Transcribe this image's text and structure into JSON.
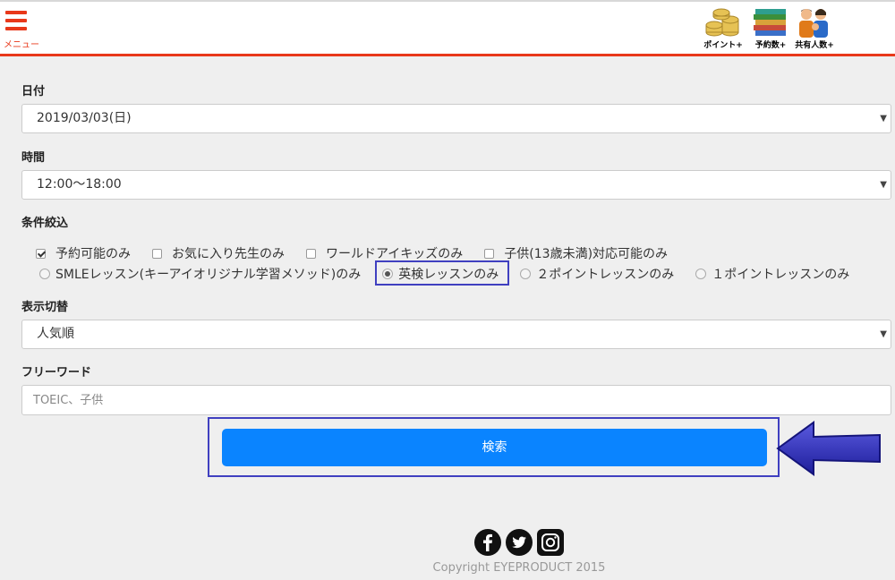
{
  "header": {
    "menu_label": "メニュー",
    "icons": [
      {
        "label": "ポイント+",
        "icon": "coins-icon"
      },
      {
        "label": "予約数+",
        "icon": "books-icon"
      },
      {
        "label": "共有人数+",
        "icon": "family-icon"
      }
    ],
    "accent_color": "#e8381a"
  },
  "form": {
    "date": {
      "label": "日付",
      "value": "2019/03/03(日)"
    },
    "time": {
      "label": "時間",
      "value": "12:00〜18:00"
    },
    "filters": {
      "label": "条件絞込",
      "checkboxes": [
        {
          "label": "予約可能のみ",
          "checked": true
        },
        {
          "label": "お気に入り先生のみ",
          "checked": false
        },
        {
          "label": "ワールドアイキッズのみ",
          "checked": false
        },
        {
          "label": "子供(13歳未満)対応可能のみ",
          "checked": false
        }
      ],
      "radios": [
        {
          "label": "SMLEレッスン(キーアイオリジナル学習メソッド)のみ",
          "checked": false
        },
        {
          "label": "英検レッスンのみ",
          "checked": true
        },
        {
          "label": "２ポイントレッスンのみ",
          "checked": false
        },
        {
          "label": "１ポイントレッスンのみ",
          "checked": false
        }
      ]
    },
    "sort": {
      "label": "表示切替",
      "value": "人気順"
    },
    "freeword": {
      "label": "フリーワード",
      "placeholder": "TOEIC、子供",
      "value": ""
    },
    "search_label": "検索",
    "button_color": "#0a84ff"
  },
  "footer": {
    "social_icons": [
      "facebook-icon",
      "twitter-icon",
      "instagram-icon"
    ],
    "copyright": "Copyright EYEPRODUCT 2015"
  }
}
